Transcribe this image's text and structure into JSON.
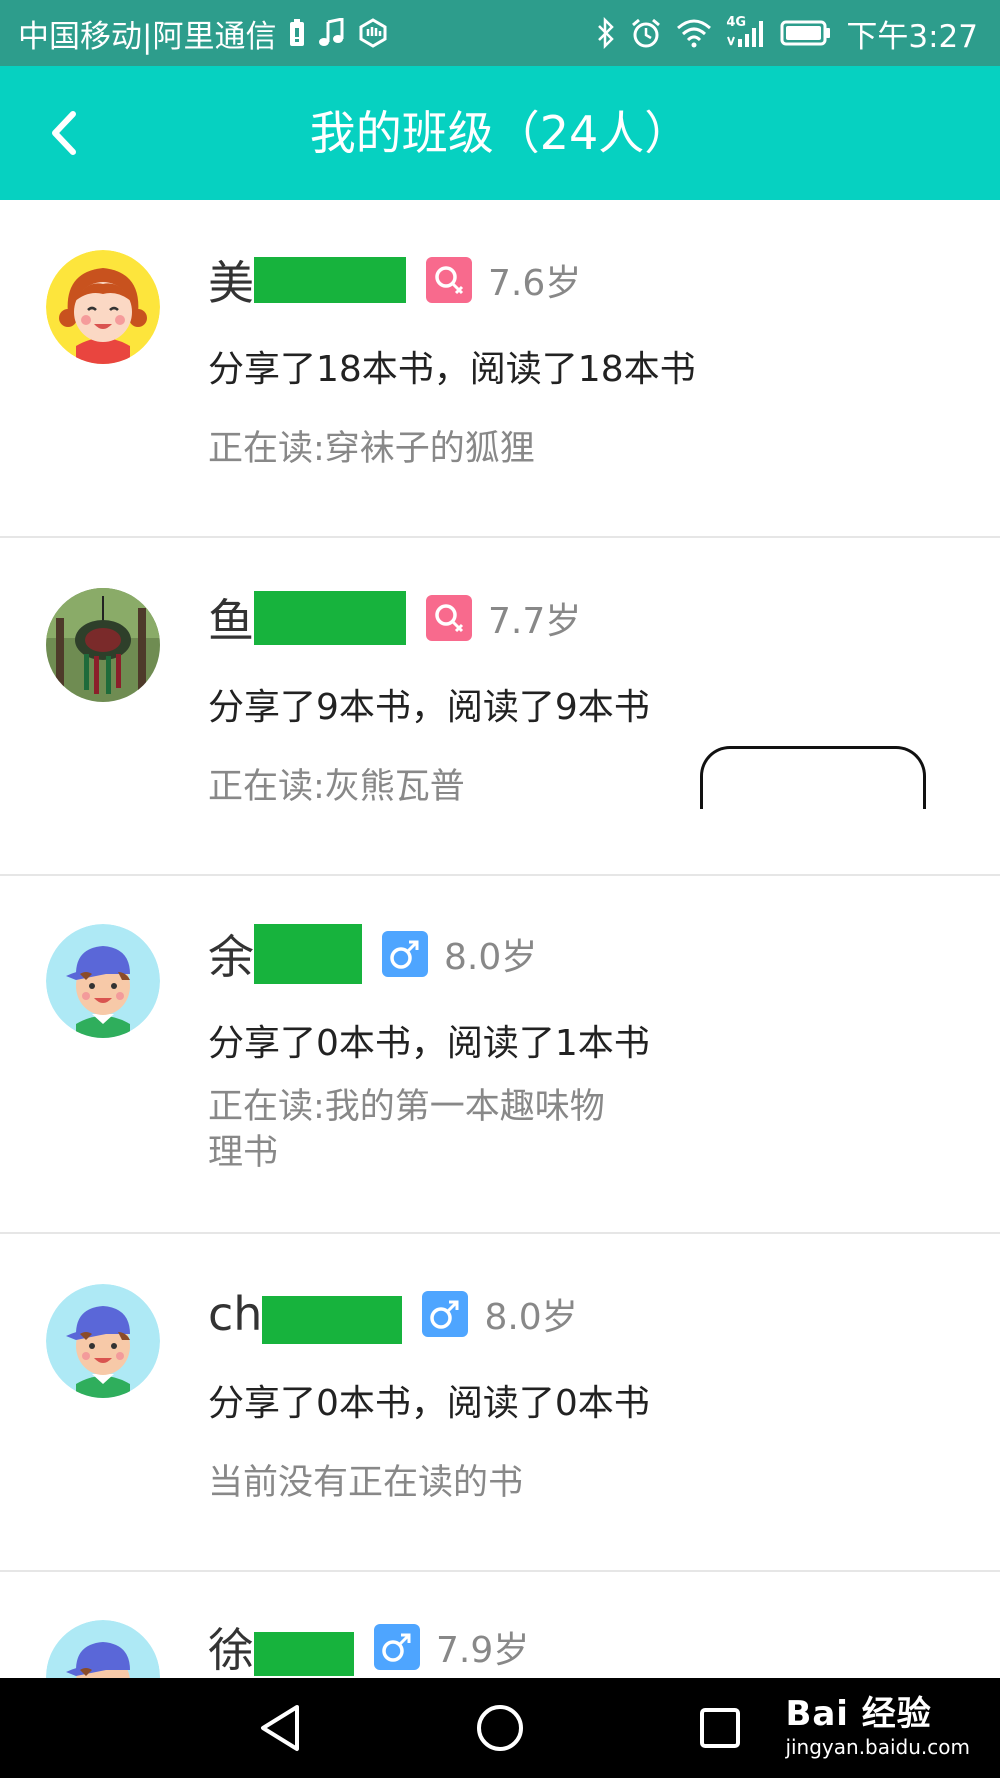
{
  "status_bar": {
    "carrier": "中国移动|阿里通信",
    "network": "4G",
    "time": "下午3:27"
  },
  "header": {
    "title": "我的班级（24人）"
  },
  "students": [
    {
      "name": "美",
      "gender": "female",
      "gender_symbol": "♀",
      "age": "7.6岁",
      "stats": "分享了18本书，阅读了18本书",
      "reading": "正在读:穿袜子的狐狸",
      "avatar_kind": "girl"
    },
    {
      "name": "鱼",
      "gender": "female",
      "gender_symbol": "♀",
      "age": "7.7岁",
      "stats": "分享了9本书，阅读了9本书",
      "reading": "正在读:灰熊瓦普",
      "avatar_kind": "photo"
    },
    {
      "name": "余",
      "gender": "male",
      "gender_symbol": "♂",
      "age": "8.0岁",
      "stats": "分享了0本书，阅读了1本书",
      "reading": "正在读:我的第一本趣味物理书",
      "avatar_kind": "boy"
    },
    {
      "name": "ch",
      "gender": "male",
      "gender_symbol": "♂",
      "age": "8.0岁",
      "stats": "分享了0本书，阅读了0本书",
      "reading": "当前没有正在读的书",
      "avatar_kind": "boy"
    },
    {
      "name": "徐",
      "gender": "male",
      "gender_symbol": "♂",
      "age": "7.9岁",
      "stats": "",
      "reading": "",
      "avatar_kind": "boy"
    }
  ],
  "watermark": {
    "brand": "Bai 经验",
    "url": "jingyan.baidu.com"
  },
  "colors": {
    "status_bar": "#2d9d8c",
    "header": "#06d1c1",
    "female_badge": "#f86a8d",
    "male_badge": "#4ea5ff",
    "redaction": "#17b33d"
  }
}
